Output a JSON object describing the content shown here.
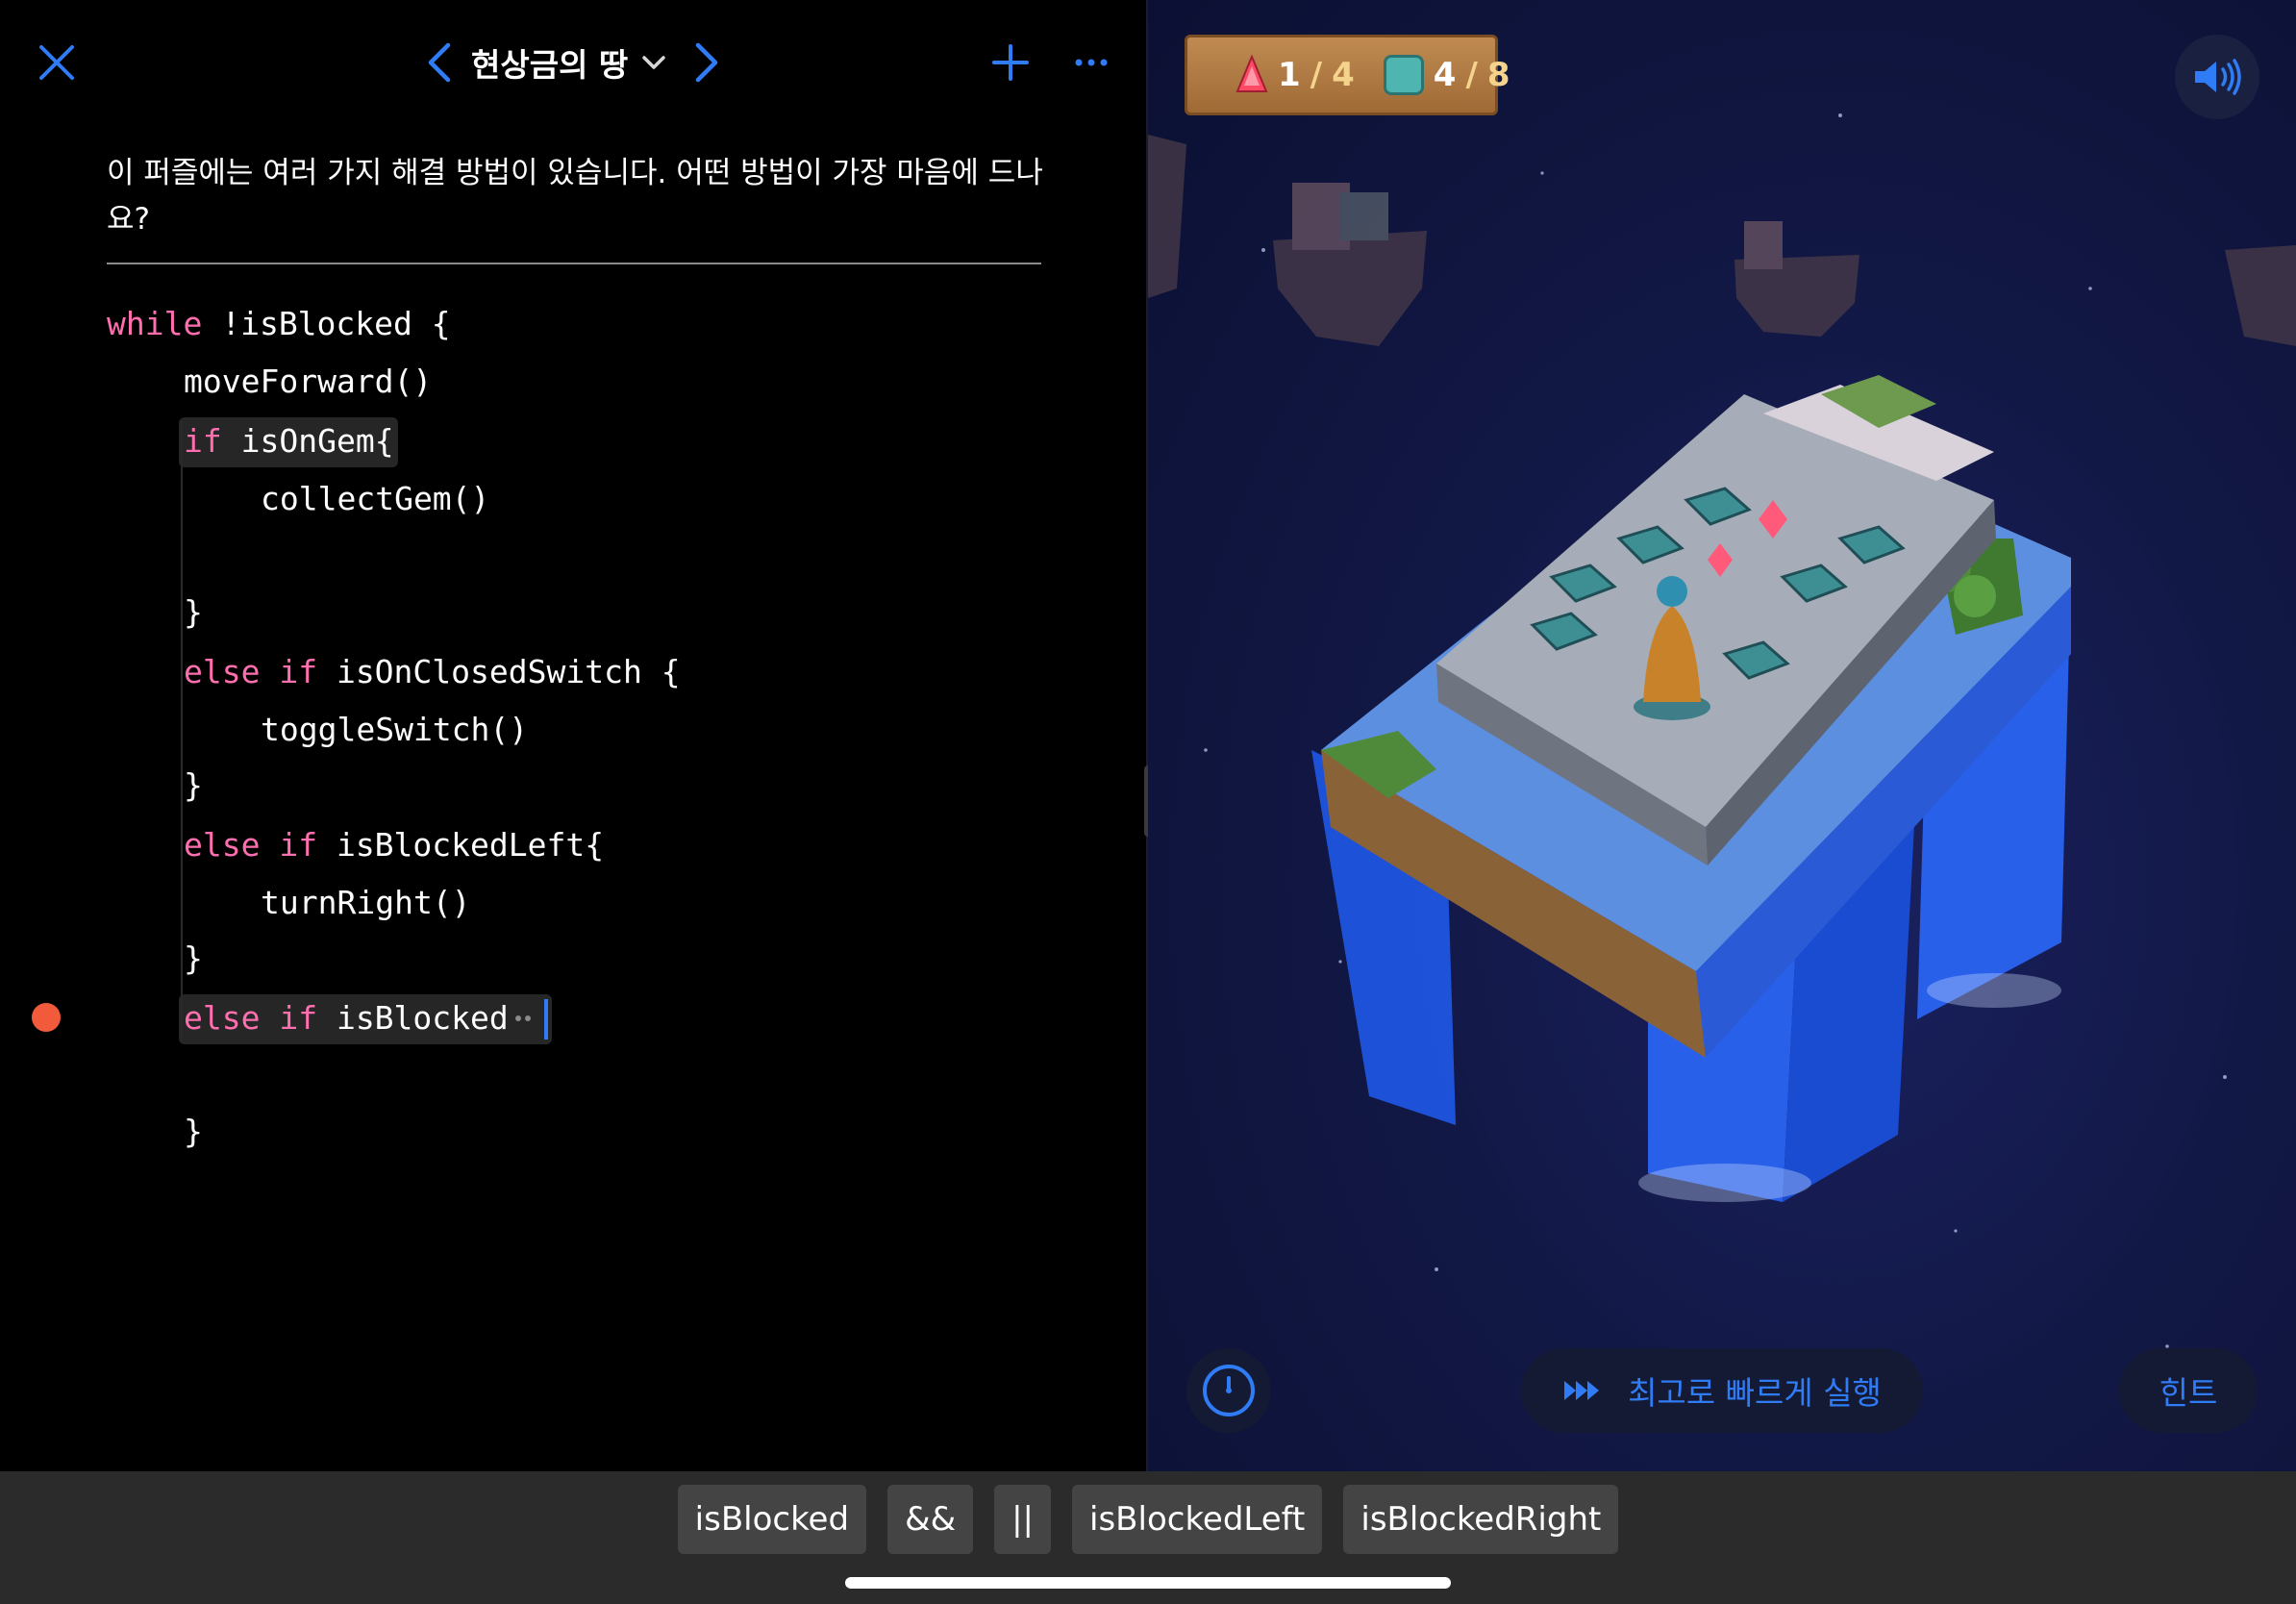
{
  "header": {
    "title": "현상금의 땅"
  },
  "instructions": "이 퍼즐에는 여러 가지 해결 방법이 있습니다. 어떤 방법이 가장 마음에 드나요?",
  "code": {
    "l1_kw": "while",
    "l1_rest": " !isBlocked {",
    "l2": "moveForward()",
    "l3_kw": "if",
    "l3_rest": " isOnGem{",
    "l4": "collectGem()",
    "l6": "}",
    "l7_kw": "else if",
    "l7_rest": " isOnClosedSwitch {",
    "l8": "toggleSwitch()",
    "l9": "}",
    "l10_kw": "else if",
    "l10_rest": " isBlockedLeft{",
    "l11": "turnRight()",
    "l12": "}",
    "l13_kw": "else if",
    "l13_rest": " isBlocked",
    "l15": "}"
  },
  "hud": {
    "gems_collected": "1",
    "gems_sep": "/",
    "gems_total": "4",
    "switches_on": "4",
    "switches_sep": "/",
    "switches_total": "8"
  },
  "controls": {
    "run_label": "최고로 빠르게 실행",
    "hint_label": "힌트"
  },
  "suggestions": [
    "isBlocked",
    "&&",
    "||",
    "isBlockedLeft",
    "isBlockedRight"
  ],
  "colors": {
    "accent": "#2f7cf6",
    "keyword": "#ff6fb0",
    "breakpoint": "#f25a3c"
  },
  "icons": {
    "close": "close-icon",
    "prev": "chevron-left-icon",
    "next": "chevron-right-icon",
    "title_menu": "chevron-down-icon",
    "add": "plus-icon",
    "more": "ellipsis-icon",
    "sound": "speaker-icon",
    "speed": "speedometer-icon",
    "run": "fast-forward-icon"
  }
}
